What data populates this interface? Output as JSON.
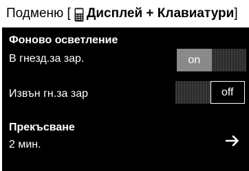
{
  "header": {
    "prefix": "Подменю [",
    "title": "Дисплей + Клавиатури",
    "suffix": "]",
    "icon": "phone-display-icon"
  },
  "backlight": {
    "heading": "Фоново осветление",
    "in_charger_label": "В гнезд.за зар.",
    "in_charger_value": "on",
    "out_charger_label": "Извън гн.за зар",
    "out_charger_value": "off"
  },
  "timeout": {
    "heading": "Прекъсване",
    "value": "2 мин.",
    "arrow_icon": "arrow-right-icon"
  },
  "colors": {
    "screen_bg": "#000000",
    "toggle_on": "#8a8a8a"
  }
}
